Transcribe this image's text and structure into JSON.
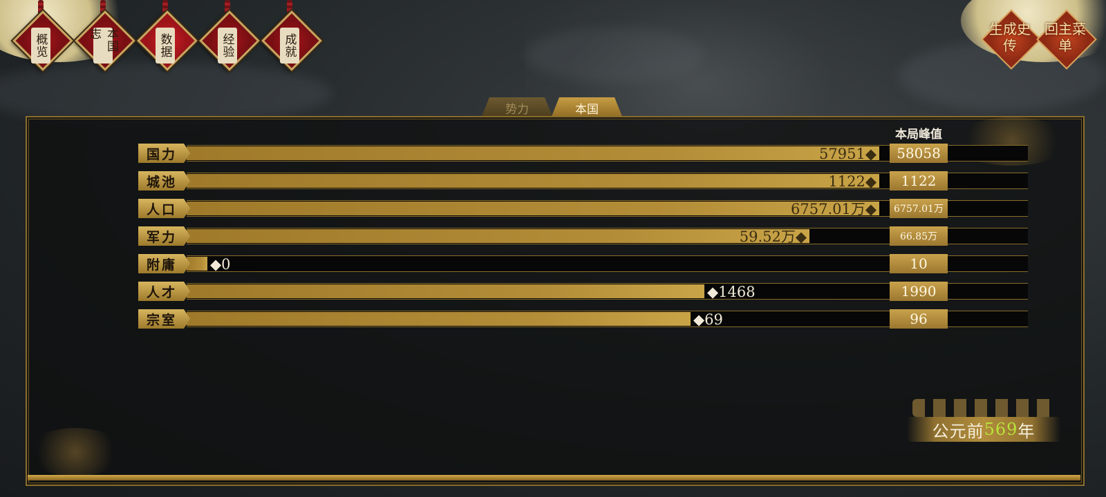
{
  "nav": {
    "items": [
      {
        "label": "概览",
        "active": false
      },
      {
        "label": "本国志",
        "active": false
      },
      {
        "label": "数据",
        "active": true
      },
      {
        "label": "经验",
        "active": false
      },
      {
        "label": "成就",
        "active": false
      }
    ]
  },
  "top_right": {
    "chronicle_label": "生成史传",
    "main_menu_label": "回主菜单"
  },
  "tabs": {
    "faction_label": "势力",
    "nation_label": "本国"
  },
  "table": {
    "peak_header": "本局峰值",
    "rows": [
      {
        "label": "国力",
        "value_text": "57951◆",
        "fill_ratio": 0.99,
        "value_inside": true,
        "peak": "58058"
      },
      {
        "label": "城池",
        "value_text": "1122◆",
        "fill_ratio": 0.99,
        "value_inside": true,
        "peak": "1122"
      },
      {
        "label": "人口",
        "value_text": "6757.01万◆",
        "fill_ratio": 0.99,
        "value_inside": true,
        "peak": "6757.01万"
      },
      {
        "label": "军力",
        "value_text": "59.52万◆",
        "fill_ratio": 0.89,
        "value_inside": true,
        "peak": "66.85万"
      },
      {
        "label": "附庸",
        "value_text": "◆0",
        "fill_ratio": 0.03,
        "value_inside": false,
        "peak": "10"
      },
      {
        "label": "人才",
        "value_text": "◆1468",
        "fill_ratio": 0.74,
        "value_inside": false,
        "peak": "1990"
      },
      {
        "label": "宗室",
        "value_text": "◆69",
        "fill_ratio": 0.72,
        "value_inside": false,
        "peak": "96"
      }
    ]
  },
  "year": {
    "prefix": "公元前",
    "number": "569",
    "suffix": "年"
  },
  "colors": {
    "gold": "#b48d38",
    "year_highlight": "#b9e13a",
    "nav_red": "#a6151b"
  }
}
